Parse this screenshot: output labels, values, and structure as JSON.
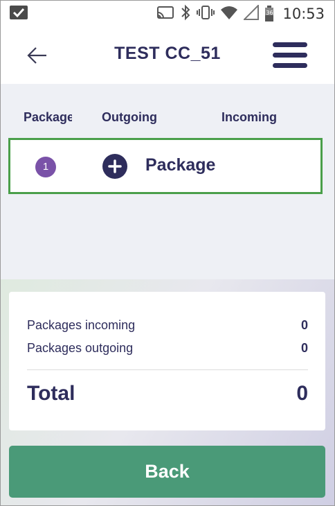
{
  "status_bar": {
    "time": "10:53",
    "battery_level": "36",
    "icons": [
      "checkbox-notification-icon",
      "cast-icon",
      "bluetooth-icon",
      "vibrate-icon",
      "wifi-icon",
      "signal-icon",
      "battery-icon"
    ]
  },
  "header": {
    "title": "TEST CC_51",
    "back_icon": "arrow-left-icon",
    "menu_icon": "hamburger-menu-icon"
  },
  "columns": {
    "package": "Package",
    "outgoing": "Outgoing",
    "incoming": "Incoming"
  },
  "rows": [
    {
      "number": "1",
      "add_icon": "plus-circle-icon",
      "label": "Package"
    }
  ],
  "summary": {
    "incoming_label": "Packages incoming",
    "incoming_value": "0",
    "outgoing_label": "Packages outgoing",
    "outgoing_value": "0",
    "total_label": "Total",
    "total_value": "0"
  },
  "footer": {
    "back_label": "Back"
  },
  "colors": {
    "primary": "#2e2d5c",
    "row_border": "#4a9f4a",
    "number_badge": "#7a52a8",
    "back_button": "#4a9a78"
  }
}
